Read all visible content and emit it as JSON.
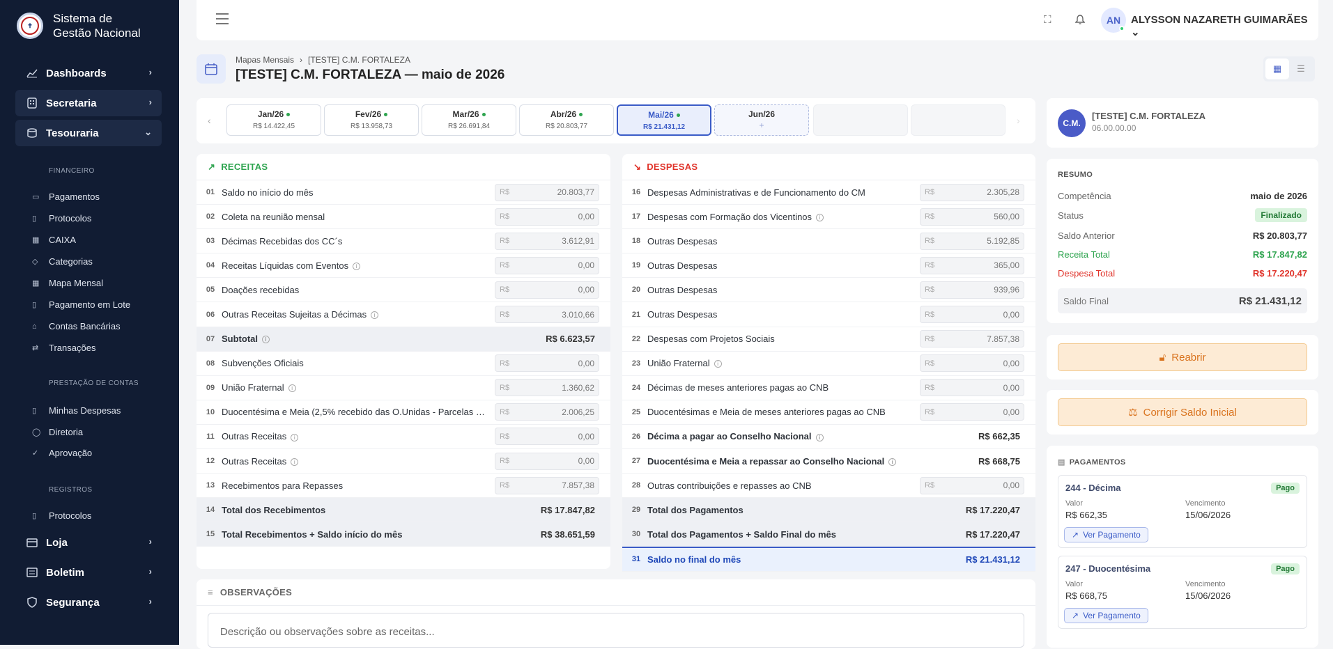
{
  "app": {
    "title_line1": "Sistema de",
    "title_line2": "Gestão Nacional",
    "logo_text": "SSVP"
  },
  "sidebar": {
    "dashboards": "Dashboards",
    "secretaria": "Secretaria",
    "tesouraria": "Tesouraria",
    "financeiro_label": "FINANCEIRO",
    "financeiro": [
      "Pagamentos",
      "Protocolos",
      "CAIXA",
      "Categorias",
      "Mapa Mensal",
      "Pagamento em Lote",
      "Contas Bancárias",
      "Transações"
    ],
    "prestacao_label": "PRESTAÇÃO DE CONTAS",
    "prestacao": [
      "Minhas Despesas",
      "Diretoria",
      "Aprovação"
    ],
    "registros_label": "REGISTROS",
    "registros": [
      "Protocolos"
    ],
    "loja": "Loja",
    "boletim": "Boletim",
    "seguranca": "Segurança"
  },
  "topbar": {
    "avatar": "AN",
    "user": "ALYSSON NAZARETH GUIMARÃES"
  },
  "page": {
    "crumb1": "Mapas Mensais",
    "crumb2": "[TESTE] C.M. FORTALEZA",
    "title": "[TESTE] C.M. FORTALEZA — maio de 2026"
  },
  "months": [
    {
      "name": "Jan/26",
      "value": "R$ 14.422,45"
    },
    {
      "name": "Fev/26",
      "value": "R$ 13.958,73"
    },
    {
      "name": "Mar/26",
      "value": "R$ 26.691,84"
    },
    {
      "name": "Abr/26",
      "value": "R$ 20.803,77"
    },
    {
      "name": "Mai/26",
      "value": "R$ 21.431,12"
    },
    {
      "name": "Jun/26",
      "value": "+"
    }
  ],
  "receitas": {
    "title": "RECEITAS",
    "rows": [
      {
        "n": "01",
        "label": "Saldo no início do mês",
        "cur": "R$",
        "value": "20.803,77"
      },
      {
        "n": "02",
        "label": "Coleta na reunião mensal",
        "cur": "R$",
        "value": "0,00"
      },
      {
        "n": "03",
        "label": "Décimas Recebidas dos CC´s",
        "cur": "R$",
        "value": "3.612,91"
      },
      {
        "n": "04",
        "label": "Receitas Líquidas com Eventos",
        "cur": "R$",
        "value": "0,00"
      },
      {
        "n": "05",
        "label": "Doações recebidas",
        "cur": "R$",
        "value": "0,00"
      },
      {
        "n": "06",
        "label": "Outras Receitas Sujeitas a Décimas",
        "cur": "R$",
        "value": "3.010,66"
      },
      {
        "n": "07",
        "label": "Subtotal",
        "value": "R$ 6.623,57"
      },
      {
        "n": "08",
        "label": "Subvenções Oficiais",
        "cur": "R$",
        "value": "0,00"
      },
      {
        "n": "09",
        "label": "União Fraternal",
        "cur": "R$",
        "value": "1.360,62"
      },
      {
        "n": "10",
        "label": "Duocentésima e Meia (2,5% recebido das O.Unidas - Parcelas C...",
        "cur": "R$",
        "value": "2.006,25"
      },
      {
        "n": "11",
        "label": "Outras Receitas",
        "cur": "R$",
        "value": "0,00"
      },
      {
        "n": "12",
        "label": "Outras Receitas",
        "cur": "R$",
        "value": "0,00"
      },
      {
        "n": "13",
        "label": "Recebimentos para Repasses",
        "cur": "R$",
        "value": "7.857,38"
      },
      {
        "n": "14",
        "label": "Total dos Recebimentos",
        "value": "R$ 17.847,82"
      },
      {
        "n": "15",
        "label": "Total Recebimentos + Saldo início do mês",
        "value": "R$ 38.651,59"
      }
    ]
  },
  "despesas": {
    "title": "DESPESAS",
    "rows": [
      {
        "n": "16",
        "label": "Despesas Administrativas e de Funcionamento do CM",
        "cur": "R$",
        "value": "2.305,28"
      },
      {
        "n": "17",
        "label": "Despesas com Formação dos Vicentinos",
        "cur": "R$",
        "value": "560,00"
      },
      {
        "n": "18",
        "label": "Outras Despesas",
        "cur": "R$",
        "value": "5.192,85"
      },
      {
        "n": "19",
        "label": "Outras Despesas",
        "cur": "R$",
        "value": "365,00"
      },
      {
        "n": "20",
        "label": "Outras Despesas",
        "cur": "R$",
        "value": "939,96"
      },
      {
        "n": "21",
        "label": "Outras Despesas",
        "cur": "R$",
        "value": "0,00"
      },
      {
        "n": "22",
        "label": "Despesas com Projetos Sociais",
        "cur": "R$",
        "value": "7.857,38"
      },
      {
        "n": "23",
        "label": "União Fraternal",
        "cur": "R$",
        "value": "0,00"
      },
      {
        "n": "24",
        "label": "Décimas de meses anteriores pagas ao CNB",
        "cur": "R$",
        "value": "0,00"
      },
      {
        "n": "25",
        "label": "Duocentésimas e Meia de meses anteriores pagas ao CNB",
        "cur": "R$",
        "value": "0,00"
      },
      {
        "n": "26",
        "label": "Décima a pagar ao Conselho Nacional",
        "value": "R$ 662,35"
      },
      {
        "n": "27",
        "label": "Duocentésima e Meia a repassar ao Conselho Nacional",
        "value": "R$ 668,75"
      },
      {
        "n": "28",
        "label": "Outras contribuições e repasses ao CNB",
        "cur": "R$",
        "value": "0,00"
      },
      {
        "n": "29",
        "label": "Total dos Pagamentos",
        "value": "R$ 17.220,47"
      },
      {
        "n": "30",
        "label": "Total dos Pagamentos + Saldo Final do mês",
        "value": "R$ 17.220,47"
      },
      {
        "n": "31",
        "label": "Saldo no final do mês",
        "value": "R$ 21.431,12"
      }
    ]
  },
  "obs": {
    "title": "OBSERVAÇÕES",
    "placeholder": "Descrição ou observações sobre as receitas..."
  },
  "entity": {
    "avatar": "C.M.",
    "name": "[TESTE] C.M. FORTALEZA",
    "code": "06.00.00.00"
  },
  "resumo": {
    "title": "RESUMO",
    "competencia_l": "Competência",
    "competencia": "maio de 2026",
    "status_l": "Status",
    "status": "Finalizado",
    "saldo_ant_l": "Saldo Anterior",
    "saldo_ant": "R$ 20.803,77",
    "receita_l": "Receita Total",
    "receita": "R$ 17.847,82",
    "despesa_l": "Despesa Total",
    "despesa": "R$ 17.220,47",
    "saldo_final_l": "Saldo Final",
    "saldo_final": "R$ 21.431,12"
  },
  "actions": {
    "reabrir": "Reabrir",
    "corrigir": "Corrigir Saldo Inicial"
  },
  "pagamentos": {
    "title": "PAGAMENTOS",
    "items": [
      {
        "title": "244 - Décima",
        "status": "Pago",
        "valor_l": "Valor",
        "valor": "R$ 662,35",
        "venc_l": "Vencimento",
        "venc": "15/06/2026",
        "link": "Ver Pagamento"
      },
      {
        "title": "247 - Duocentésima",
        "status": "Pago",
        "valor_l": "Valor",
        "valor": "R$ 668,75",
        "venc_l": "Vencimento",
        "venc": "15/06/2026",
        "link": "Ver Pagamento"
      }
    ]
  },
  "colors": {
    "sidebar": "#111c33",
    "accent": "#3a5bc7",
    "receita": "#2ea44f",
    "despesa": "#e0342b",
    "warning": "#d9731e"
  }
}
